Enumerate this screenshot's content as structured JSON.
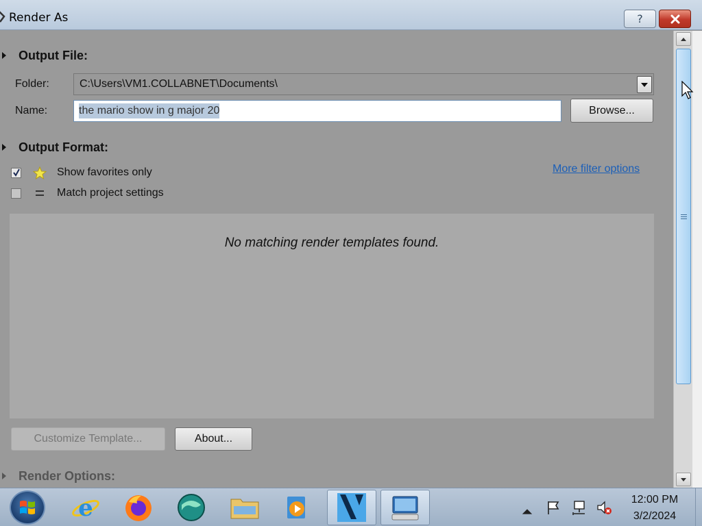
{
  "window": {
    "title": "Render As",
    "help_label": "?"
  },
  "output_file": {
    "heading": "Output File:",
    "folder_label": "Folder:",
    "folder_value": "C:\\Users\\VM1.COLLABNET\\Documents\\",
    "name_label": "Name:",
    "name_value": "the mario show  in g major 20",
    "browse_label": "Browse..."
  },
  "output_format": {
    "heading": "Output Format:",
    "show_favorites_label": "Show favorites only",
    "show_favorites_checked": true,
    "match_project_label": "Match project settings",
    "match_project_checked": false,
    "more_filter_label": "More filter options",
    "empty_message": "No matching render templates found."
  },
  "buttons": {
    "customize_label": "Customize Template...",
    "about_label": "About..."
  },
  "render_options": {
    "heading": "Render Options:"
  },
  "taskbar": {
    "apps": [
      "internet-explorer",
      "firefox",
      "app-sphere",
      "file-explorer",
      "media-player",
      "vegas-render",
      "remote-desktop"
    ],
    "time": "12:00 PM",
    "date": "3/2/2024"
  },
  "colors": {
    "link": "#1b5fb8",
    "close": "#c0392b",
    "selection": "#b7c9dd"
  }
}
